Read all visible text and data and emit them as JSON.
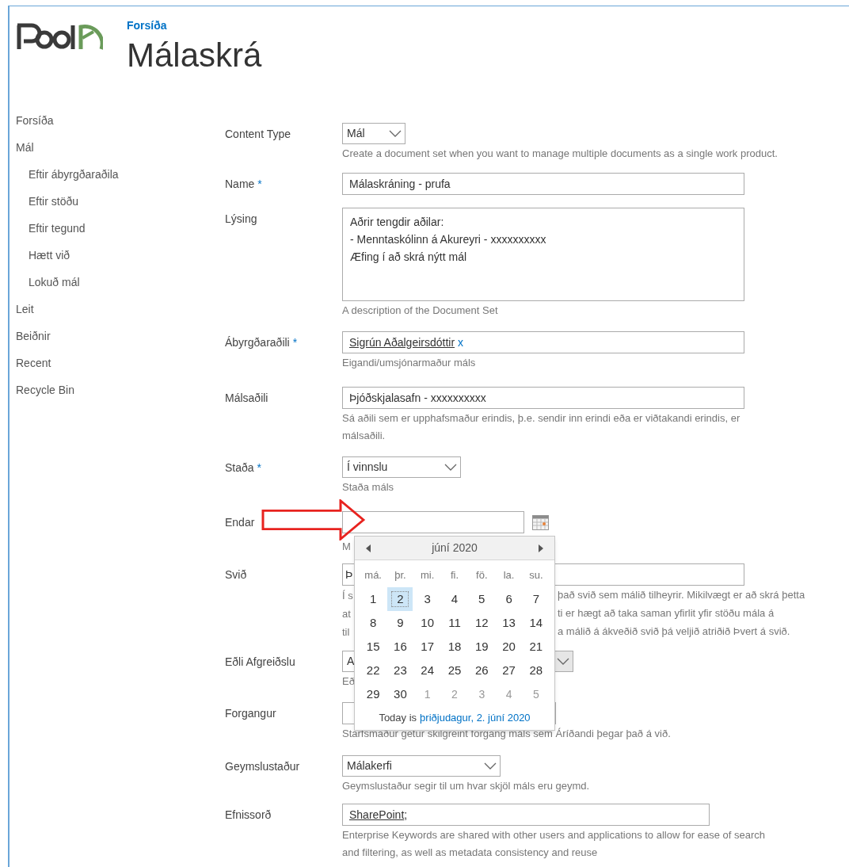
{
  "header": {
    "breadcrumb": "Forsíða",
    "title": "Málaskrá"
  },
  "nav": [
    {
      "label": "Forsíða"
    },
    {
      "label": "Mál",
      "children": [
        {
          "label": "Eftir ábyrgðaraðila"
        },
        {
          "label": "Eftir stöðu"
        },
        {
          "label": "Eftir tegund"
        },
        {
          "label": "Hætt við"
        },
        {
          "label": "Lokuð mál"
        }
      ]
    },
    {
      "label": "Leit"
    },
    {
      "label": "Beiðnir"
    },
    {
      "label": "Recent"
    },
    {
      "label": "Recycle Bin"
    }
  ],
  "form": {
    "required_marker": "*",
    "fields": [
      {
        "kind": "select",
        "label": "Content Type",
        "required": false,
        "value": "Mál",
        "description": [
          [
            "Create a document set when you want to manage multiple documents as a single work product."
          ]
        ]
      },
      {
        "kind": "text",
        "label": "Name",
        "required": true,
        "value": "Málaskráning - prufa"
      },
      {
        "kind": "textarea",
        "label": "Lýsing",
        "required": false,
        "lines": [
          "Aðrir tengdir aðilar:",
          "- Menntaskólinn á Akureyri - xxxxxxxxxx",
          "Æfing í að skrá nýtt mál"
        ],
        "description": [
          [
            "A description of the Document Set"
          ]
        ]
      },
      {
        "kind": "people",
        "label": "Ábyrgðaraðili",
        "required": true,
        "value": "Sigrún Aðalgeirsdóttir",
        "remove": "x",
        "description": [
          [
            "Eigandi/umsjónarmaður máls"
          ]
        ]
      },
      {
        "kind": "text",
        "label": "Málsaðili",
        "required": false,
        "value": "Þjóðskjalasafn - xxxxxxxxxx",
        "description": [
          [
            "Sá aðili sem er upphafsmaður erindis, þ.e. sendir inn erindi eða er viðtakandi erindis, er"
          ],
          [
            "málsaðili."
          ]
        ]
      },
      {
        "kind": "select",
        "label": "Staða",
        "required": true,
        "value": "Í vinnslu",
        "description": [
          [
            "Staða máls"
          ]
        ]
      },
      {
        "kind": "date",
        "label": "Endar",
        "required": false,
        "description": [
          [
            "M"
          ]
        ]
      },
      {
        "kind": "text",
        "label": "Svið",
        "required": false,
        "value": "Þ",
        "description": [
          [
            "Í s",
            "það svið sem málið tilheyrir. Mikilvægt er að skrá þetta"
          ],
          [
            "at",
            "ti er hægt að taka saman yfirlit yfir stöðu mála á"
          ],
          [
            "til",
            "a málið á ákveðið svið þá veljið atriðið Þvert á svið."
          ]
        ]
      },
      {
        "kind": "select",
        "label": "Eðli Afgreiðslu",
        "required": false,
        "value": "A",
        "disabled": true,
        "description": [
          [
            "Eð"
          ]
        ]
      },
      {
        "kind": "text",
        "label": "Forgangur",
        "required": false,
        "description": [
          [
            "Starfsmaður getur skilgreint forgang máls sem Áríðandi þegar það á við."
          ]
        ]
      },
      {
        "kind": "select",
        "label": "Geymslustaður",
        "required": false,
        "value": "Málakerfi",
        "description": [
          [
            "Geymslustaður segir til um hvar skjöl máls eru geymd."
          ]
        ]
      },
      {
        "kind": "keyword",
        "label": "Efnissorð",
        "required": false,
        "value": "SharePoint",
        "separator": ";",
        "description": [
          [
            "Enterprise Keywords are shared with other users and applications to allow for ease of search"
          ],
          [
            "and filtering, as well as metadata consistency and reuse"
          ]
        ]
      }
    ]
  },
  "date_picker": {
    "month": "júní 2020",
    "weekdays": [
      "má.",
      "þr.",
      "mi.",
      "fi.",
      "fö.",
      "la.",
      "su."
    ],
    "weeks": [
      [
        {
          "day": "1",
          "other_month": false,
          "selected": false
        },
        {
          "day": "2",
          "other_month": false,
          "selected": true
        },
        {
          "day": "3",
          "other_month": false,
          "selected": false
        },
        {
          "day": "4",
          "other_month": false,
          "selected": false
        },
        {
          "day": "5",
          "other_month": false,
          "selected": false
        },
        {
          "day": "6",
          "other_month": false,
          "selected": false
        },
        {
          "day": "7",
          "other_month": false,
          "selected": false
        }
      ],
      [
        {
          "day": "8",
          "other_month": false,
          "selected": false
        },
        {
          "day": "9",
          "other_month": false,
          "selected": false
        },
        {
          "day": "10",
          "other_month": false,
          "selected": false
        },
        {
          "day": "11",
          "other_month": false,
          "selected": false
        },
        {
          "day": "12",
          "other_month": false,
          "selected": false
        },
        {
          "day": "13",
          "other_month": false,
          "selected": false
        },
        {
          "day": "14",
          "other_month": false,
          "selected": false
        }
      ],
      [
        {
          "day": "15",
          "other_month": false,
          "selected": false
        },
        {
          "day": "16",
          "other_month": false,
          "selected": false
        },
        {
          "day": "17",
          "other_month": false,
          "selected": false
        },
        {
          "day": "18",
          "other_month": false,
          "selected": false
        },
        {
          "day": "19",
          "other_month": false,
          "selected": false
        },
        {
          "day": "20",
          "other_month": false,
          "selected": false
        },
        {
          "day": "21",
          "other_month": false,
          "selected": false
        }
      ],
      [
        {
          "day": "22",
          "other_month": false,
          "selected": false
        },
        {
          "day": "23",
          "other_month": false,
          "selected": false
        },
        {
          "day": "24",
          "other_month": false,
          "selected": false
        },
        {
          "day": "25",
          "other_month": false,
          "selected": false
        },
        {
          "day": "26",
          "other_month": false,
          "selected": false
        },
        {
          "day": "27",
          "other_month": false,
          "selected": false
        },
        {
          "day": "28",
          "other_month": false,
          "selected": false
        }
      ],
      [
        {
          "day": "29",
          "other_month": false,
          "selected": false
        },
        {
          "day": "30",
          "other_month": false,
          "selected": false
        },
        {
          "day": "1",
          "other_month": true,
          "selected": false
        },
        {
          "day": "2",
          "other_month": true,
          "selected": false
        },
        {
          "day": "3",
          "other_month": true,
          "selected": false
        },
        {
          "day": "4",
          "other_month": true,
          "selected": false
        },
        {
          "day": "5",
          "other_month": true,
          "selected": false
        }
      ]
    ],
    "today_prefix": "Today is",
    "today_link": "þriðjudagur, 2. júní 2020"
  }
}
